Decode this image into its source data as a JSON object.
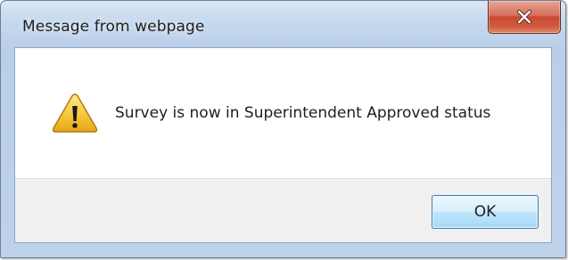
{
  "dialog": {
    "title": "Message from webpage",
    "message": "Survey is now in Superintendent Approved status",
    "icon": "warning-icon",
    "ok_label": "OK",
    "close_icon": "close-icon"
  },
  "colors": {
    "close_button": "#c74a31",
    "ok_border": "#3c7fb1",
    "warning_yellow": "#f2c52e"
  }
}
